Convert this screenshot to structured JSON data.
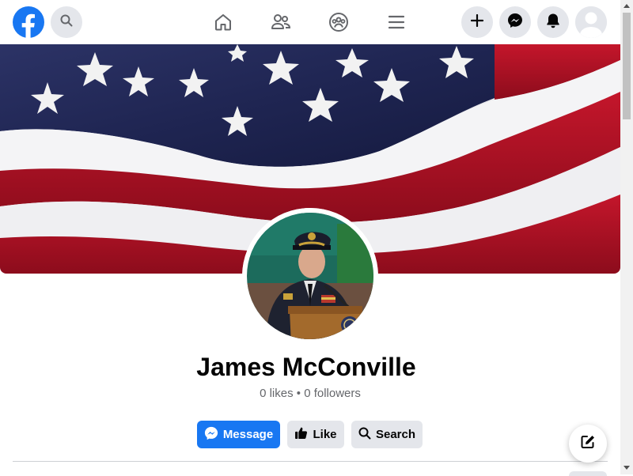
{
  "nav": {
    "logo_icon": "facebook-logo-icon",
    "search_icon": "search-icon",
    "center_icons": [
      "home-icon",
      "friends-icon",
      "groups-icon",
      "menu-icon"
    ],
    "right_icons": [
      "plus-icon",
      "messenger-icon",
      "bell-icon",
      "avatar"
    ]
  },
  "profile": {
    "name": "James McConville",
    "stats": "0 likes • 0 followers"
  },
  "actions": {
    "message_label": "Message",
    "like_label": "Like",
    "search_label": "Search"
  },
  "colors": {
    "brand": "#1877f2",
    "button_gray": "#e4e6eb",
    "text_secondary": "#65676b"
  }
}
